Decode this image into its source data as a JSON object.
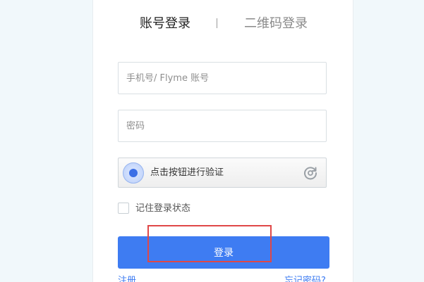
{
  "tabs": {
    "account": "账号登录",
    "separator": "|",
    "qrcode": "二维码登录"
  },
  "form": {
    "account_placeholder": "手机号/ Flyme 账号",
    "password_placeholder": "密码",
    "verify_label": "点击按钮进行验证",
    "remember_label": "记住登录状态",
    "remember_checked": false,
    "login_label": "登录"
  },
  "links": {
    "register": "注册",
    "forgot": "忘记密码?"
  },
  "colors": {
    "accent": "#3e7cf2",
    "highlight": "#e04848",
    "background": "#f1f8fb"
  },
  "icons": {
    "verify": "verify-badge-icon",
    "refresh": "refresh-icon"
  }
}
